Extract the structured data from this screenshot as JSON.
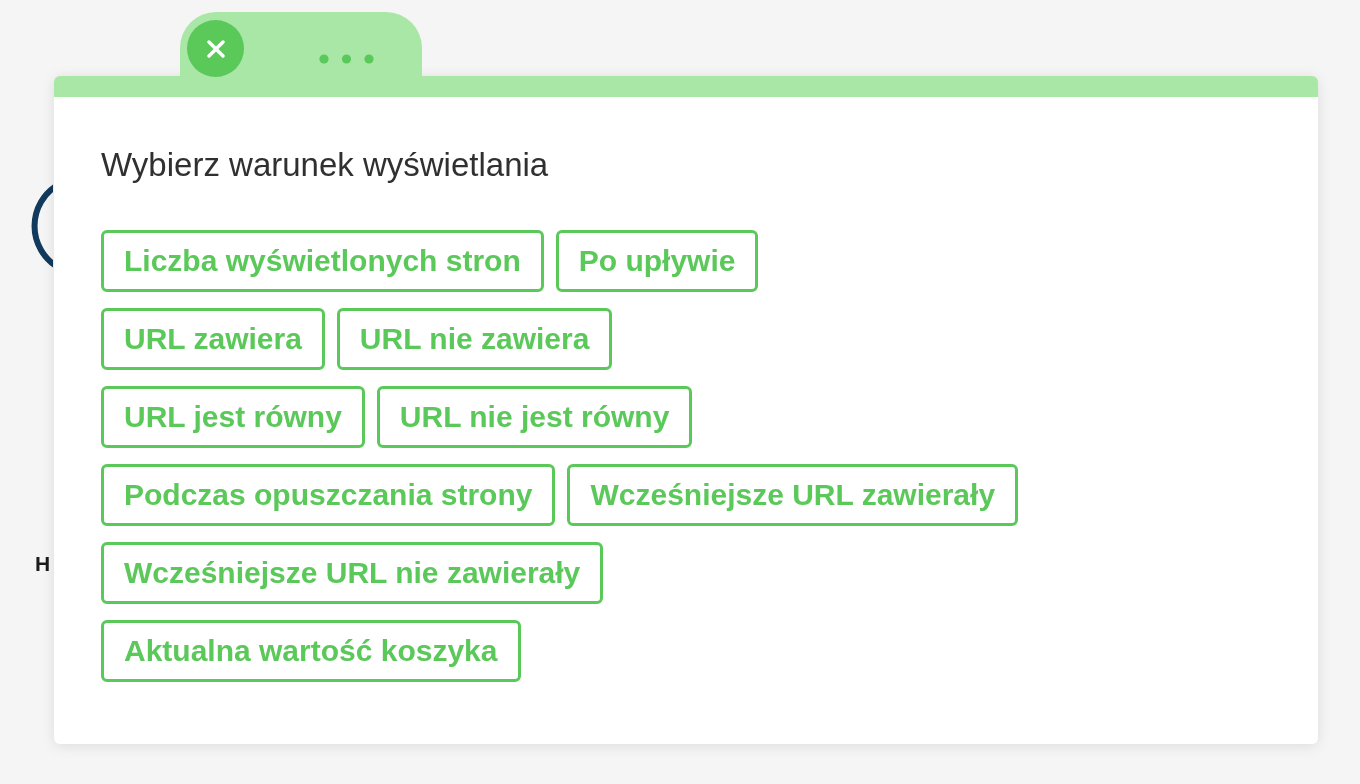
{
  "background": {
    "letter": "H"
  },
  "popup": {
    "heading": "Wybierz warunek wyświetlania",
    "option_rows": [
      [
        "Liczba wyświetlonych stron",
        "Po upływie"
      ],
      [
        "URL zawiera",
        "URL nie zawiera"
      ],
      [
        "URL jest równy",
        "URL nie jest równy"
      ],
      [
        "Podczas opuszczania strony",
        "Wcześniejsze URL zawierały"
      ],
      [
        "Wcześniejsze URL nie zawierały"
      ],
      [
        "Aktualna wartość koszyka"
      ]
    ]
  }
}
